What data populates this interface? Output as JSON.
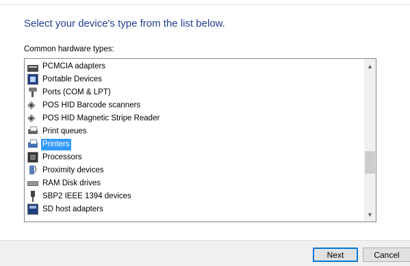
{
  "dialog": {
    "heading": "Select your device's type from the list below.",
    "list_label": "Common hardware types:"
  },
  "hardware_types": [
    {
      "label": "PCMCIA adapters",
      "icon": "pcmcia-adapter-icon",
      "selected": false
    },
    {
      "label": "Portable Devices",
      "icon": "portable-device-icon",
      "selected": false
    },
    {
      "label": "Ports (COM & LPT)",
      "icon": "port-connector-icon",
      "selected": false
    },
    {
      "label": "POS HID Barcode scanners",
      "icon": "pos-device-icon",
      "selected": false
    },
    {
      "label": "POS HID Magnetic Stripe Reader",
      "icon": "pos-device-icon",
      "selected": false
    },
    {
      "label": "Print queues",
      "icon": "print-queue-icon",
      "selected": false
    },
    {
      "label": "Printers",
      "icon": "printer-icon",
      "selected": true
    },
    {
      "label": "Processors",
      "icon": "processor-icon",
      "selected": false
    },
    {
      "label": "Proximity devices",
      "icon": "proximity-device-icon",
      "selected": false
    },
    {
      "label": "RAM Disk drives",
      "icon": "ram-disk-icon",
      "selected": false
    },
    {
      "label": "SBP2 IEEE 1394 devices",
      "icon": "sbp2-device-icon",
      "selected": false
    },
    {
      "label": "SD host adapters",
      "icon": "sd-host-adapter-icon",
      "selected": false
    }
  ],
  "buttons": {
    "next": "Next",
    "cancel": "Cancel"
  },
  "colors": {
    "heading": "#1f3d8c",
    "selection": "#3399ff"
  }
}
